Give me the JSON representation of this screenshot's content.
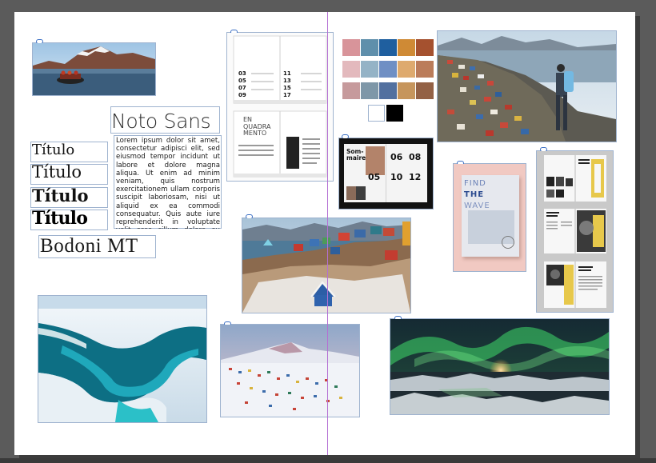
{
  "fonts": {
    "noto": "Noto Sans",
    "titulo": "Título",
    "bodoni": "Bodoni MT"
  },
  "lorem": "Lorem ipsum dolor sit amet, consectetur adipisci elit, sed eiusmod tempor incidunt ut labore et dolore magna aliqua. Ut enim ad minim veniam, quis nostrum exercitationem ullam corporis suscipit laboriosam, nisi ut aliquid ex ea commodi consequatur. Quis aute iure reprehenderit in voluptate velit esse cillum dolore eu fugiat nulla pariatur. Excepteur sint obcaecat cupiditat non proident, sunt in culpa qui officia deserunt mollit",
  "toc": {
    "left_numbers": [
      "03",
      "05",
      "07",
      "09"
    ],
    "right_numbers": [
      "11",
      "13",
      "15",
      "17"
    ]
  },
  "quadramento": {
    "title_lines": [
      "EN",
      "QUADRA",
      "MENTO"
    ]
  },
  "sommaire": {
    "title_lines": [
      "Som-",
      "maire"
    ],
    "numbers": [
      "06",
      "08",
      "05",
      "10",
      "12"
    ]
  },
  "wave": {
    "lines": [
      "FIND",
      "THE",
      "WAVE"
    ]
  },
  "palette": {
    "rows": [
      [
        "#d8949a",
        "#5f8fab",
        "#1f5f9f",
        "#cf8a35",
        "#a5512f"
      ],
      [
        "#e3b9bd",
        "#94b3c6",
        "#6f8fc4",
        "#deaa6e",
        "#bb7c5a"
      ],
      [
        "#c69a9c",
        "#7e97a8",
        "#52709f",
        "#c6955c",
        "#936145"
      ]
    ],
    "bw": [
      "#ffffff",
      "#000000"
    ]
  }
}
